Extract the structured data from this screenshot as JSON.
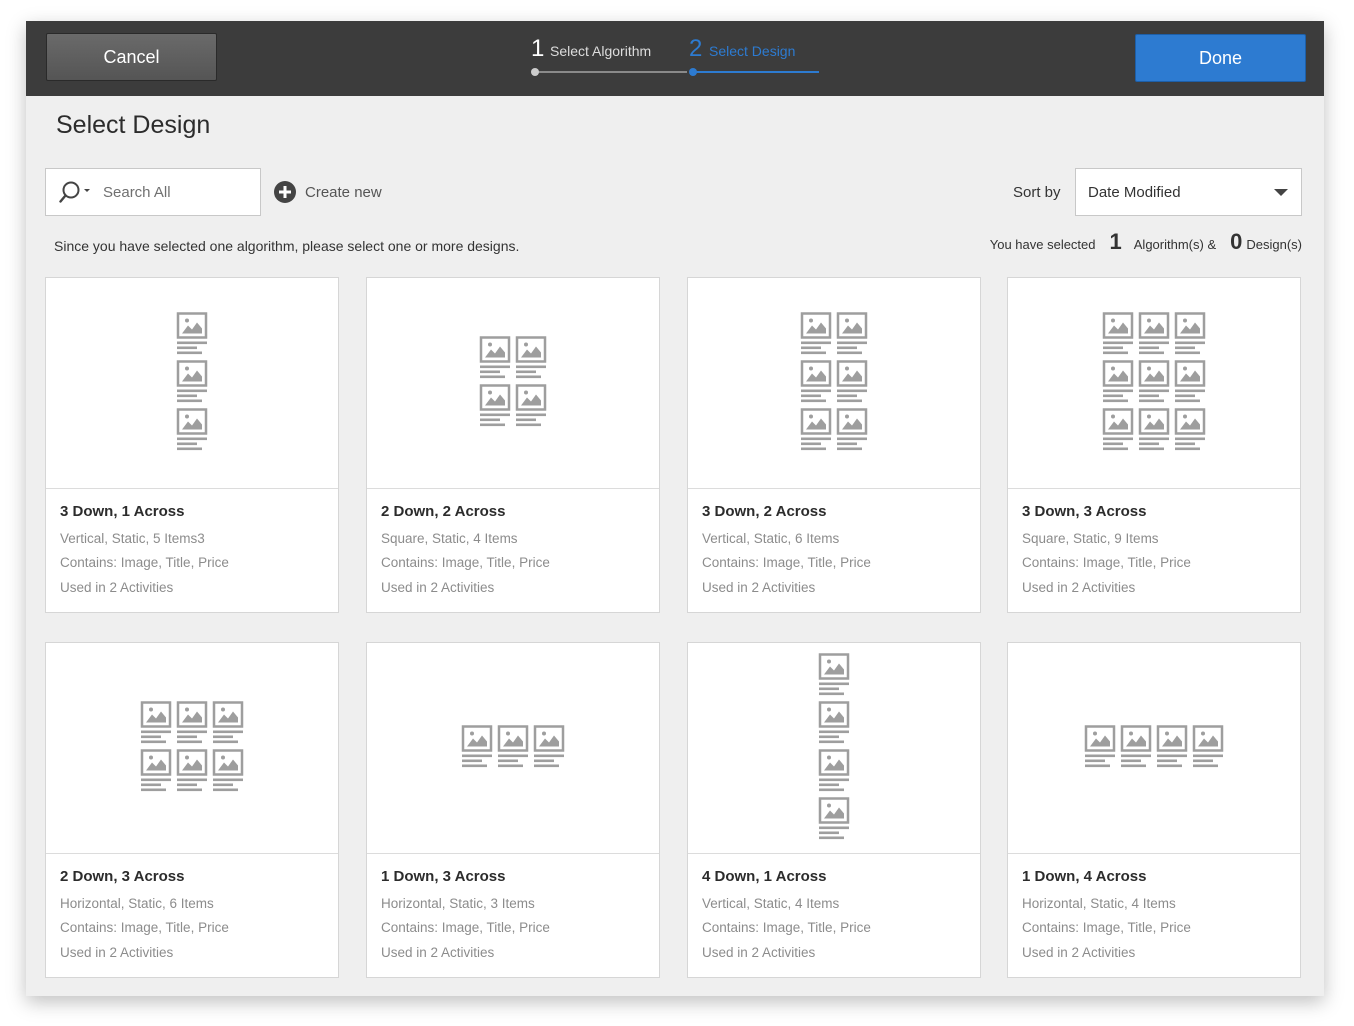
{
  "header": {
    "cancel_label": "Cancel",
    "done_label": "Done",
    "steps": [
      {
        "number": "1",
        "label": "Select Algorithm"
      },
      {
        "number": "2",
        "label": "Select Design"
      }
    ]
  },
  "page": {
    "title": "Select Design",
    "instruction": "Since you have selected one algorithm, please select one or more designs."
  },
  "search": {
    "placeholder": "Search All"
  },
  "create_new_label": "Create new",
  "sort": {
    "label": "Sort by",
    "value": "Date Modified"
  },
  "selection": {
    "prefix": "You have selected",
    "algorithms_count": "1",
    "algorithms_label": "Algorithm(s) &",
    "designs_count": "0",
    "designs_label": "Design(s)"
  },
  "colors": {
    "accent": "#2d7bd1",
    "topbar": "#3c3c3c",
    "icon_gray": "#9e9e9e"
  },
  "designs": [
    {
      "title": "3 Down, 1 Across",
      "rows": 3,
      "cols": 1,
      "meta": "Vertical, Static, 5 Items3",
      "contains": "Contains: Image, Title, Price",
      "usage": "Used in 2 Activities"
    },
    {
      "title": "2 Down, 2 Across",
      "rows": 2,
      "cols": 2,
      "meta": "Square, Static, 4 Items",
      "contains": "Contains: Image, Title, Price",
      "usage": "Used in 2 Activities"
    },
    {
      "title": "3 Down, 2 Across",
      "rows": 3,
      "cols": 2,
      "meta": "Vertical, Static, 6 Items",
      "contains": "Contains: Image, Title, Price",
      "usage": "Used in 2 Activities"
    },
    {
      "title": "3 Down, 3 Across",
      "rows": 3,
      "cols": 3,
      "meta": "Square, Static, 9 Items",
      "contains": "Contains: Image, Title, Price",
      "usage": "Used in 2 Activities"
    },
    {
      "title": "2 Down, 3 Across",
      "rows": 2,
      "cols": 3,
      "meta": "Horizontal, Static, 6 Items",
      "contains": "Contains: Image, Title, Price",
      "usage": "Used in 2 Activities"
    },
    {
      "title": "1 Down, 3 Across",
      "rows": 1,
      "cols": 3,
      "meta": "Horizontal, Static, 3 Items",
      "contains": "Contains: Image, Title, Price",
      "usage": "Used in 2 Activities"
    },
    {
      "title": "4 Down, 1 Across",
      "rows": 4,
      "cols": 1,
      "meta": "Vertical, Static, 4 Items",
      "contains": "Contains: Image, Title, Price",
      "usage": "Used in 2 Activities"
    },
    {
      "title": "1 Down, 4 Across",
      "rows": 1,
      "cols": 4,
      "meta": "Horizontal, Static, 4 Items",
      "contains": "Contains: Image, Title, Price",
      "usage": "Used in 2 Activities"
    }
  ]
}
